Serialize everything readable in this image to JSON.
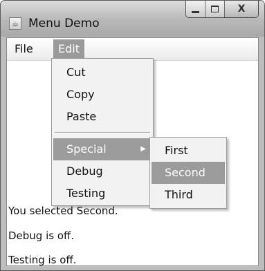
{
  "window": {
    "title": "Menu Demo",
    "app_icon": "java-coffee-icon",
    "minimize": "minimize-icon",
    "maximize": "maximize-icon",
    "close_label": "X"
  },
  "menubar": {
    "file_label": "File",
    "edit_label": "Edit"
  },
  "edit_menu": {
    "items": [
      {
        "label": "Cut"
      },
      {
        "label": "Copy"
      },
      {
        "label": "Paste"
      },
      {
        "label": "Special",
        "has_submenu": true,
        "selected": true
      },
      {
        "label": "Debug"
      },
      {
        "label": "Testing"
      }
    ]
  },
  "special_menu": {
    "items": [
      {
        "label": "First"
      },
      {
        "label": "Second",
        "selected": true
      },
      {
        "label": "Third"
      }
    ]
  },
  "status": {
    "line1": "You selected Second.",
    "line2": "Debug is off.",
    "line3": "Testing is off."
  },
  "colors": {
    "selection": "#9b9b9b",
    "menu_bg": "#f2f2f2",
    "titlebar": "#c0c0c0"
  }
}
